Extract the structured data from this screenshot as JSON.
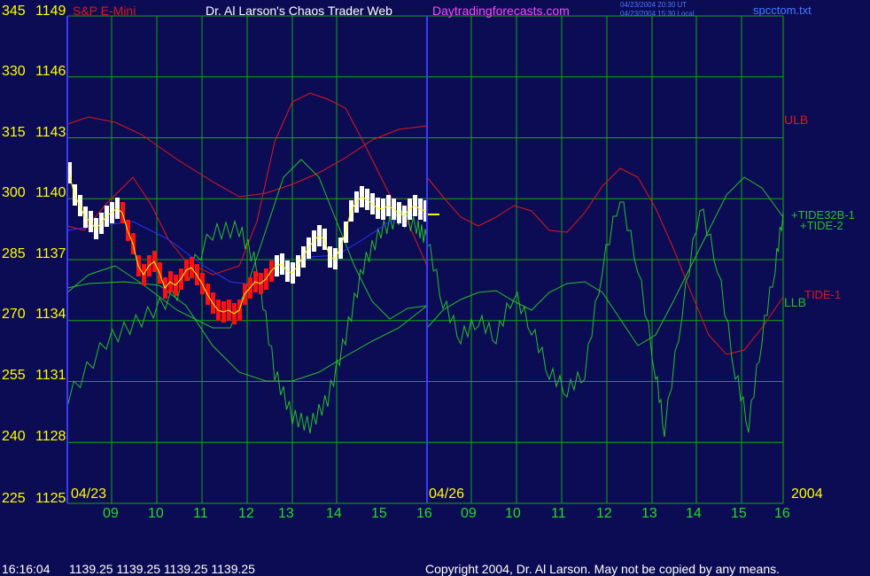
{
  "header": {
    "instrument": "S&P E-Mini",
    "site_title": "Dr. Al Larson's Chaos Trader Web",
    "site_url": "Daytradingforecasts.com",
    "timestamp_ut": "04/23/2004 20:30 UT",
    "timestamp_local": "04/23/2004 15:30 Local",
    "file_name": "spcctom.txt"
  },
  "colors": {
    "background": "#0c0c54",
    "grid": "#11a811",
    "axis": "#3a3aff",
    "axis_text": "#ffff00",
    "time_text": "#22dd22",
    "red_lines": "#e01818",
    "tide_green": "#28c028",
    "price_white": "#ffffff",
    "price_red": "#ff1010",
    "price_yellow": "#ffff00",
    "site_url_color": "#ff44ff"
  },
  "axes": {
    "y_left_ticks": [
      "345",
      "330",
      "315",
      "300",
      "285",
      "270",
      "255",
      "240",
      "225"
    ],
    "y_price_ticks": [
      "1149",
      "1146",
      "1143",
      "1140",
      "1137",
      "1134",
      "1131",
      "1128",
      "1125"
    ],
    "date_labels": {
      "start": "04/23",
      "mid": "04/26",
      "year": "2004"
    },
    "x_ticks": [
      "09",
      "10",
      "11",
      "12",
      "13",
      "14",
      "15",
      "16",
      "09",
      "10",
      "11",
      "12",
      "13",
      "14",
      "15",
      "16"
    ]
  },
  "chart_data": {
    "type": "line",
    "series": [
      {
        "name": "ULB",
        "color": "red"
      },
      {
        "name": "LLB",
        "color": "green"
      },
      {
        "name": "+TIDE32B-1",
        "color": "green"
      },
      {
        "name": "+TIDE-2",
        "color": "green"
      },
      {
        "name": "TIDE-1",
        "color": "red"
      }
    ],
    "price_range": [
      1125,
      1149
    ],
    "left_scale_range": [
      225,
      345
    ],
    "grid": true,
    "last_price": 1139.25
  },
  "footer": {
    "time": "16:16:04",
    "prices": "1139.25 1139.25 1139.25 1139.25",
    "copyright": "Copyright 2004, Dr. Al Larson. May not be copied by any means."
  }
}
